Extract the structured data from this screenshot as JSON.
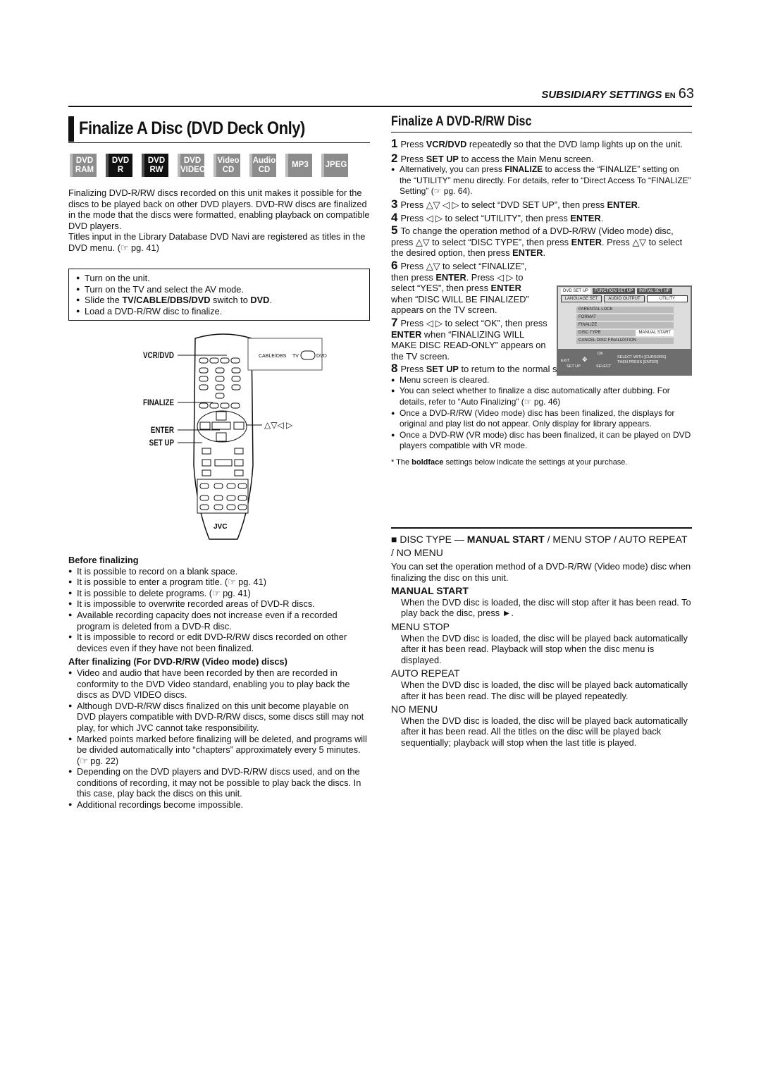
{
  "header": {
    "section": "SUBSIDIARY SETTINGS",
    "lang": "EN",
    "page": "63"
  },
  "left": {
    "title": "Finalize A Disc (DVD Deck Only)",
    "badges": [
      {
        "l1": "DVD",
        "l2": "RAM",
        "active": false
      },
      {
        "l1": "DVD",
        "l2": "R",
        "active": true
      },
      {
        "l1": "DVD",
        "l2": "RW",
        "active": true
      },
      {
        "l1": "DVD",
        "l2": "VIDEO",
        "active": false
      },
      {
        "l1": "Video",
        "l2": "CD",
        "active": false
      },
      {
        "l1": "Audio",
        "l2": "CD",
        "active": false
      },
      {
        "l1": "MP3",
        "l2": "",
        "active": false
      },
      {
        "l1": "JPEG",
        "l2": "",
        "active": false
      }
    ],
    "intro1": "Finalizing DVD-R/RW discs recorded on this unit makes it possible for the discs to be played back on other DVD players. DVD-RW discs are finalized in the mode that the discs were formatted, enabling playback on compatible DVD players.",
    "intro2": "Titles input in the Library Database DVD Navi are registered as titles in the DVD menu. (☞ pg. 41)",
    "prep": [
      [
        [
          "Turn on the unit.",
          0
        ]
      ],
      [
        [
          "Turn on the TV and select the AV mode.",
          0
        ]
      ],
      [
        [
          "Slide the ",
          0
        ],
        [
          "TV/CABLE/DBS/DVD",
          1
        ],
        [
          " switch to ",
          0
        ],
        [
          "DVD",
          1
        ],
        [
          ".",
          0
        ]
      ],
      [
        [
          "Load a DVD-R/RW disc to finalize.",
          0
        ]
      ]
    ],
    "remote": {
      "vcr_dvd": "VCR/DVD",
      "finalize": "FINALIZE",
      "enter": "ENTER",
      "setup": "SET UP",
      "cursors": "△▽◁ ▷",
      "switch_cable": "CABLE/DBS",
      "switch_tv": "TV",
      "switch_dvd": "DVD",
      "brand": "JVC"
    },
    "before_heading": "Before finalizing",
    "before": [
      "It is possible to record on a blank space.",
      "It is possible to enter a program title. (☞ pg. 41)",
      "It is possible to delete programs. (☞ pg. 41)",
      "It is impossible to overwrite recorded areas of DVD-R discs.",
      "Available recording capacity does not increase even if a recorded program is deleted from a DVD-R disc.",
      "It is impossible to record or edit DVD-R/RW discs recorded on other devices even if they have not been finalized."
    ],
    "after_heading": "After finalizing (For DVD-R/RW (Video mode) discs)",
    "after": [
      "Video and audio that have been recorded by then are recorded in conformity to the DVD Video standard, enabling you to play back the discs as DVD VIDEO discs.",
      "Although DVD-R/RW discs finalized on this unit become playable on DVD players compatible with DVD-R/RW discs, some discs still may not play, for which JVC cannot take responsibility.",
      "Marked points marked before finalizing will be deleted, and programs will be divided automatically into “chapters” approximately every 5 minutes. (☞ pg. 22)",
      "Depending on the DVD players and DVD-R/RW discs used, and on the conditions of recording, it may not be possible to play back the discs. In this case, play back the discs on this unit.",
      "Additional recordings become impossible."
    ]
  },
  "right": {
    "subtitle": "Finalize A DVD-R/RW Disc",
    "step1": [
      [
        "Press ",
        0
      ],
      [
        "VCR/DVD",
        1
      ],
      [
        " repeatedly so that the DVD lamp lights up on the unit.",
        0
      ]
    ],
    "step2": [
      [
        "Press ",
        0
      ],
      [
        "SET UP",
        1
      ],
      [
        " to access the Main Menu screen.",
        0
      ]
    ],
    "step2_note": [
      [
        "Alternatively, you can press ",
        0
      ],
      [
        "FINALIZE",
        1
      ],
      [
        " to access the “FINALIZE” setting on the “UTILITY” menu directly. For details, refer to “Direct Access To “FINALIZE” Setting” (☞ pg. 64).",
        0
      ]
    ],
    "step3": [
      [
        "Press △▽ ◁ ▷ to select “DVD SET UP”, then press ",
        0
      ],
      [
        "ENTER",
        1
      ],
      [
        ".",
        0
      ]
    ],
    "step4": [
      [
        "Press ◁ ▷ to select “UTILITY”, then press ",
        0
      ],
      [
        "ENTER",
        1
      ],
      [
        ".",
        0
      ]
    ],
    "step5": [
      [
        "To change the operation method of a DVD-R/RW (Video mode) disc, press △▽ to select “DISC TYPE”, then press ",
        0
      ],
      [
        "ENTER",
        1
      ],
      [
        ". Press △▽ to select the desired option, then press ",
        0
      ],
      [
        "ENTER",
        1
      ],
      [
        ".",
        0
      ]
    ],
    "step6": [
      [
        "Press △▽ to select “FINALIZE”, then press ",
        0
      ],
      [
        "ENTER",
        1
      ],
      [
        ". Press ◁ ▷ to select “YES”, then press ",
        0
      ],
      [
        "ENTER",
        1
      ],
      [
        " when “DISC WILL BE FINALIZED” appears on the TV screen.",
        0
      ]
    ],
    "step7": [
      [
        "Press ◁ ▷ to select “OK”, then press ",
        0
      ],
      [
        "ENTER",
        1
      ],
      [
        " when “FINALIZING WILL MAKE DISC READ-ONLY” appears on the TV screen.",
        0
      ]
    ],
    "step8": [
      [
        "Press ",
        0
      ],
      [
        "SET UP",
        1
      ],
      [
        " to return to the normal screen.",
        0
      ]
    ],
    "notes": [
      [
        [
          "Menu screen is cleared.",
          0
        ]
      ],
      [
        [
          "You can select whether to finalize a disc automatically after dubbing. For details, refer to “Auto Finalizing” (☞ pg. 46)",
          0
        ]
      ],
      [
        [
          "Once a DVD-R/RW (Video mode) disc has been finalized, the displays for original and play list do not appear. Only display for library appears.",
          0
        ]
      ],
      [
        [
          "Once a DVD-RW (VR mode) disc has been finalized, it can be played on DVD players compatible with VR mode.",
          0
        ]
      ]
    ],
    "footnote": [
      [
        "* The ",
        0
      ],
      [
        "boldface",
        1
      ],
      [
        " settings below indicate the settings at your purchase.",
        0
      ]
    ],
    "menu": {
      "tabs": [
        "DVD SET UP",
        "FUNCTION SET UP",
        "INITIAL SET UP"
      ],
      "subtabs": [
        "LANGUAGE SET",
        "AUDIO OUTPUT",
        "UTILITY"
      ],
      "items": [
        "PARENTAL LOCK",
        "FORMAT",
        "FINALIZE",
        "DISC TYPE",
        "CANCEL DISC FINALIZATION"
      ],
      "disc_type_value": "MANUAL START",
      "exit": "EXIT",
      "setup": "SET UP",
      "ok": "OK",
      "select": "SELECT",
      "help1": "SELECT WITH [CURSORS]",
      "help2": "THEN PRESS [ENTER]"
    },
    "disc_type_heading": [
      [
        "■ DISC TYPE  — ",
        0
      ],
      [
        "MANUAL START",
        1
      ],
      [
        " / MENU STOP / AUTO REPEAT / NO MENU",
        0
      ]
    ],
    "disc_type_desc": "You can set the operation method of a DVD-R/RW (Video mode) disc when finalizing the disc on this unit.",
    "options": [
      {
        "name": "MANUAL START",
        "bold": true,
        "desc": "When the DVD disc is loaded, the disc will stop after it has been read. To play back the disc, press ►."
      },
      {
        "name": "MENU STOP",
        "bold": false,
        "desc": "When the DVD disc is loaded, the disc will be played back automatically after it has been read. Playback will stop when the disc menu is displayed."
      },
      {
        "name": "AUTO REPEAT",
        "bold": false,
        "desc": "When the DVD disc is loaded, the disc will be played back automatically after it has been read. The disc will be played repeatedly."
      },
      {
        "name": "NO MENU",
        "bold": false,
        "desc": "When the DVD disc is loaded, the disc will be played back automatically after it has been read. All the titles on the disc will be played back sequentially; playback will stop when the last title is played."
      }
    ]
  }
}
